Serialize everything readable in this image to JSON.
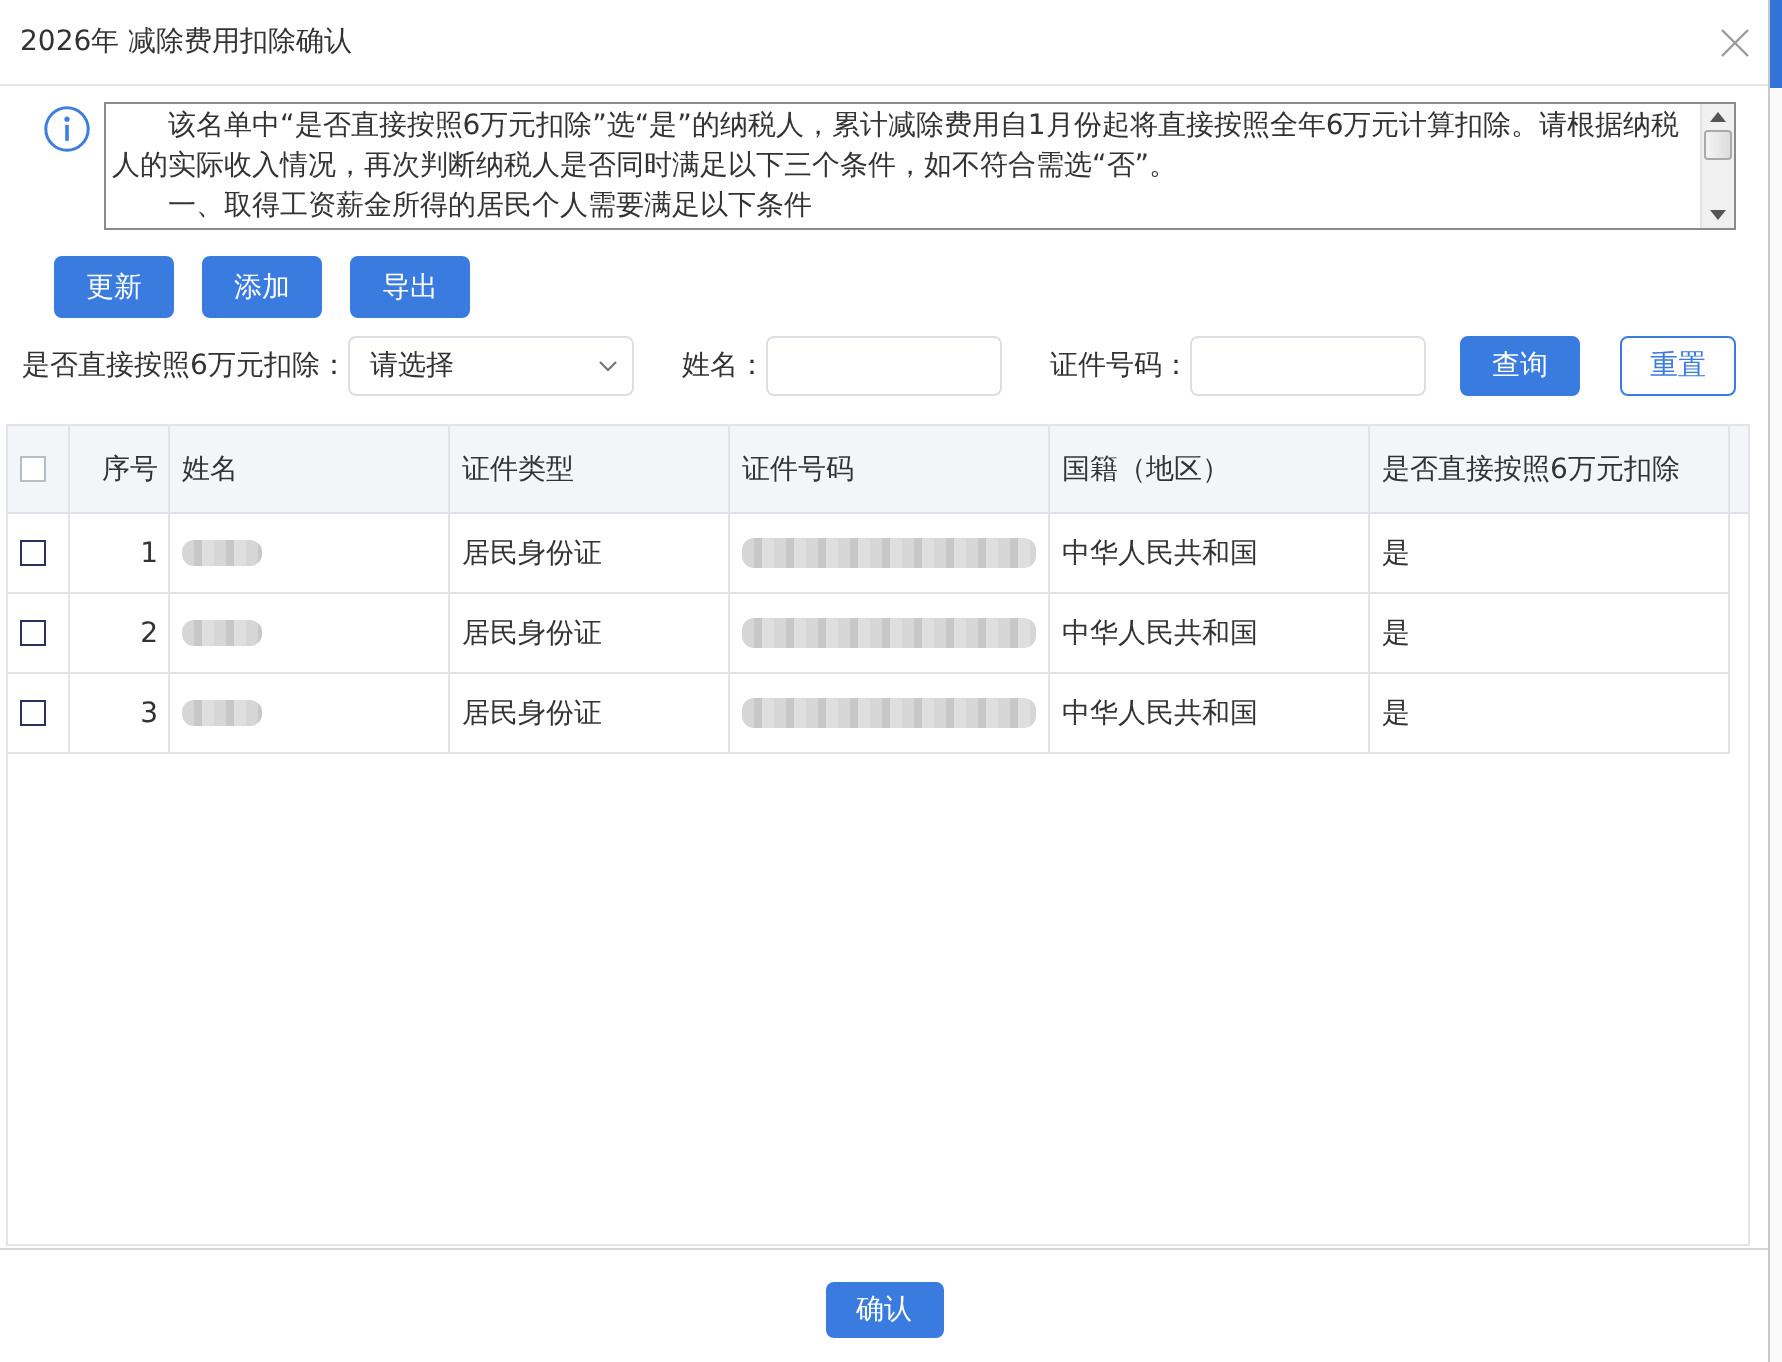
{
  "dialog": {
    "title": "2026年 减除费用扣除确认"
  },
  "notice": {
    "paragraphs": [
      "该名单中“是否直接按照6万元扣除”选“是”的纳税人，累计减除费用自1月份起将直接按照全年6万元计算扣除。请根据纳税人的实际收入情况，再次判断纳税人是否同时满足以下三个条件，如不符合需选“否”。",
      "一、取得工资薪金所得的居民个人需要满足以下条件"
    ]
  },
  "toolbar": [
    {
      "label": "更新"
    },
    {
      "label": "添加"
    },
    {
      "label": "导出"
    }
  ],
  "filters": [
    {
      "kind": "select",
      "label": "是否直接按照6万元扣除：",
      "placeholder": "请选择"
    },
    {
      "kind": "text",
      "label": "姓名："
    },
    {
      "kind": "text",
      "label": "证件号码："
    }
  ],
  "filter_buttons": [
    {
      "kind": "primary",
      "label": "查询"
    },
    {
      "kind": "outline",
      "label": "重置"
    }
  ],
  "table": {
    "select_all": {
      "checked": false
    },
    "columns": [
      "序号",
      "姓名",
      "证件类型",
      "证件号码",
      "国籍（地区）",
      "是否直接按照6万元扣除"
    ],
    "rows": [
      {
        "checked": false,
        "index": "1",
        "id_type": "居民身份证",
        "nationality": "中华人民共和国",
        "direct_deduction": "是"
      },
      {
        "checked": false,
        "index": "2",
        "id_type": "居民身份证",
        "nationality": "中华人民共和国",
        "direct_deduction": "是"
      },
      {
        "checked": false,
        "index": "3",
        "id_type": "居民身份证",
        "nationality": "中华人民共和国",
        "direct_deduction": "是"
      }
    ]
  },
  "footer": {
    "confirm_button": "确认"
  }
}
